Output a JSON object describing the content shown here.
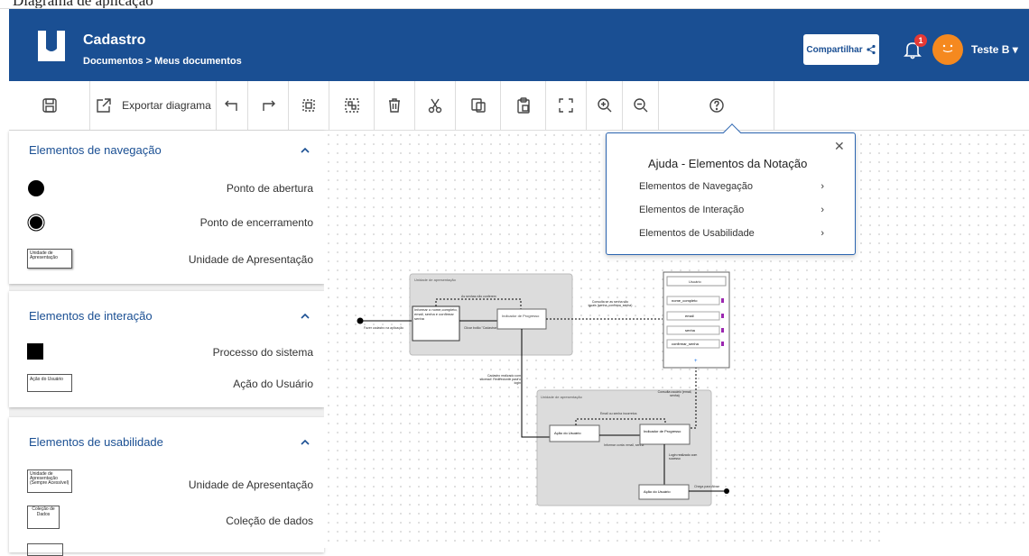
{
  "page_top_text": "Diagrama de aplicação",
  "header": {
    "title": "Cadastro",
    "breadcrumb": "Documentos > Meus documentos",
    "share_label": "Compartilhar",
    "notification_count": "1",
    "user_name": "Teste B",
    "brand_color": "#1a4f93"
  },
  "toolbar": {
    "export_label": "Exportar diagrama",
    "tools": [
      "save-icon",
      "export-icon",
      "undo-icon",
      "redo-icon",
      "select-icon",
      "group-icon",
      "delete-icon",
      "cut-icon",
      "copy-icon",
      "paste-icon",
      "fit-icon",
      "zoom-in-icon",
      "zoom-out-icon",
      "help-icon"
    ]
  },
  "sidebar": {
    "nav": {
      "title": "Elementos de navegação",
      "items": [
        {
          "label": "Ponto de abertura"
        },
        {
          "label": "Ponto de encerramento"
        },
        {
          "label": "Unidade de Apresentação",
          "thumb": "Unidade de Apresentação"
        }
      ]
    },
    "interaction": {
      "title": "Elementos de interação",
      "items": [
        {
          "label": "Processo do sistema"
        },
        {
          "label": "Ação do Usuário",
          "thumb": "Ação do Usuário"
        }
      ]
    },
    "usability": {
      "title": "Elementos de usabilidade",
      "items": [
        {
          "label": "Unidade de Apresentação",
          "thumb": "Unidade de Apresentação (Sempre Acessível)"
        },
        {
          "label": "Coleção de dados",
          "thumb": "Coleção de Dados"
        }
      ]
    }
  },
  "help": {
    "title": "Ajuda - Elementos da Notação",
    "items": [
      "Elementos de Navegação",
      "Elementos de Interação",
      "Elementos de Usabilidade"
    ]
  },
  "diagram": {
    "group1": "Unidade de apresentação",
    "group2": "Unidade de apresentação",
    "start_label": "Fazer cadastro na aplicação",
    "box_inform": "Informar o nome,completo, email, senha e confirmar senha",
    "box_progress1": "Indicador de Progresso",
    "label_password_mismatch": "As senhas não conferem",
    "label_button": "Clicar botão \"Cadastrar\"",
    "label_consult": "Consulta se as senha são iguais (senha, confirma_senha)",
    "entity_title": "Usuário",
    "entity_fields": [
      "nome_completo",
      "email",
      "senha",
      "confirmar_senha"
    ],
    "label_success": "Cadastro realizado com sucesso. Redirecionar para o login",
    "label_consult2": "Consulta usuário (email, senha)",
    "label_wrong": "Email ou senha incorretos",
    "box_action1": "Ação do Usuário",
    "box_progress2": "Indicador de Progresso",
    "label_inform_login": "Informar conta: email, senha",
    "label_login_ok": "Login realizado com sucesso",
    "box_action2": "Ação do Usuário",
    "label_end": "Chega para Ativar"
  }
}
